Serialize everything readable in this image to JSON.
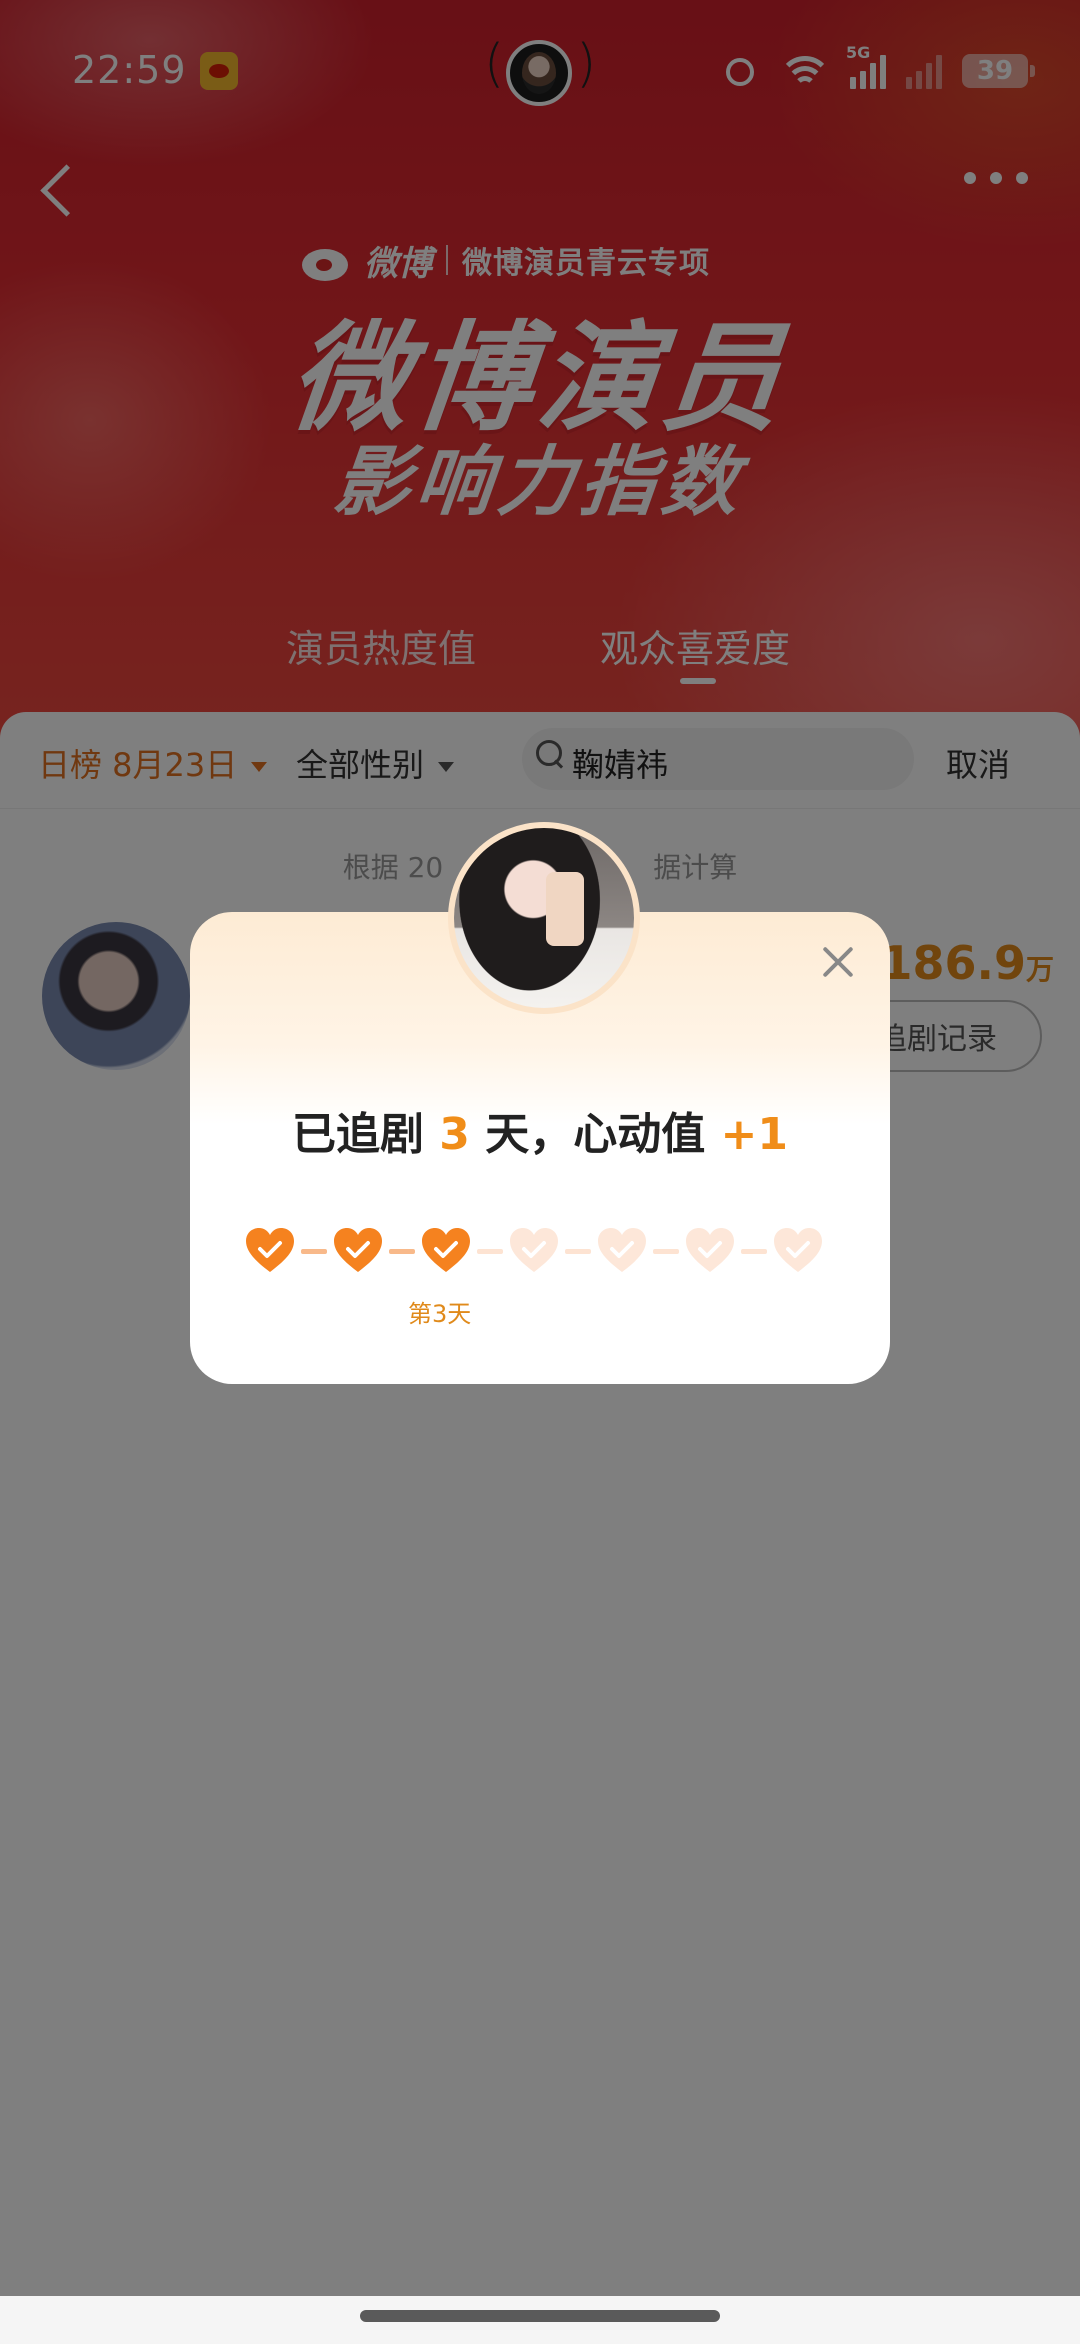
{
  "status_bar": {
    "time": "22:59",
    "network_label": "5G",
    "battery": "39"
  },
  "header": {
    "brand_logo": "微博",
    "brand_sub": "微博演员青云专项",
    "title_line1": "微博演员",
    "title_line2": "影响力指数",
    "tabs": [
      {
        "label": "演员热度值",
        "active": false
      },
      {
        "label": "观众喜爱度",
        "active": true
      }
    ]
  },
  "filters": {
    "date": "日榜 8月23日",
    "gender": "全部性别",
    "search_value": "鞠婧祎",
    "cancel": "取消"
  },
  "list": {
    "note": "根据 20",
    "note_tail": "据计算",
    "row": {
      "score": "186.9",
      "score_unit": "万",
      "button": "追剧记录"
    }
  },
  "modal": {
    "text_prefix": "已追剧 ",
    "days": "3",
    "text_mid": " 天，心动值 ",
    "delta": "+1",
    "hearts_total": 7,
    "hearts_checked": 3,
    "day_label": "第3天"
  },
  "colors": {
    "accent": "#f08d19",
    "heart_active": "#f5821f",
    "heart_inactive": "#fde7d9"
  }
}
